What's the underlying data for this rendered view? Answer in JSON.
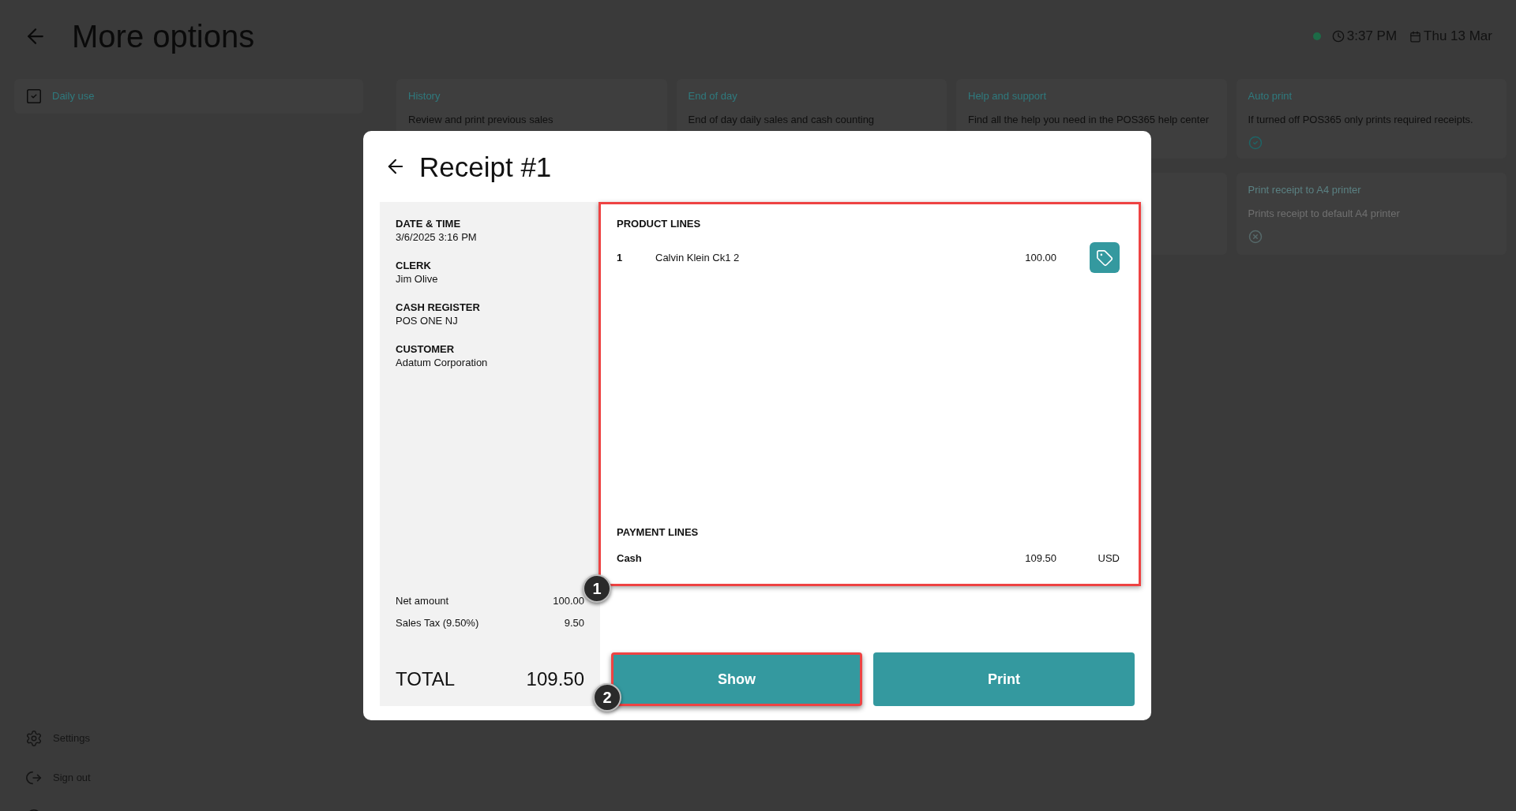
{
  "header": {
    "title": "More options",
    "time": "3:37 PM",
    "date": "Thu 13 Mar"
  },
  "sidebar": {
    "items": [
      {
        "label": "Daily use",
        "selected": true
      }
    ],
    "footer_items": [
      {
        "kind": "settings",
        "label": "Settings"
      },
      {
        "kind": "sign_out",
        "label": "Sign out"
      },
      {
        "kind": "help"
      }
    ]
  },
  "cards": [
    {
      "kind": "link",
      "title": "History",
      "description": "Review and print previous sales"
    },
    {
      "kind": "link",
      "title": "End of day",
      "description": "End of day daily sales and cash counting"
    },
    {
      "kind": "link",
      "title": "Help and support",
      "description": "Find all the help you need in the POS365 help center"
    },
    {
      "kind": "toggle",
      "title": "Auto print",
      "description": "If turned off POS365 only prints required receipts.",
      "on": true
    },
    {
      "kind": "blank"
    },
    {
      "kind": "toggle",
      "title": "Print receipt to A4 printer",
      "description": "Prints receipt to default A4 printer",
      "on": false
    }
  ],
  "receipt": {
    "title": "Receipt #1",
    "details": [
      {
        "label": "DATE & TIME",
        "value": "3/6/2025 3:16 PM"
      },
      {
        "label": "CLERK",
        "value": "Jim Olive"
      },
      {
        "label": "CASH REGISTER",
        "value": "POS ONE NJ"
      },
      {
        "label": "CUSTOMER",
        "value": "Adatum Corporation"
      }
    ],
    "summary": [
      {
        "label": "Net amount",
        "value": "100.00"
      },
      {
        "label": "Sales Tax (9.50%)",
        "value": "9.50"
      }
    ],
    "total": {
      "label": "TOTAL",
      "value": "109.50"
    },
    "lines_panel": {
      "highlighted": true,
      "callout": "1"
    },
    "product_lines": {
      "heading": "PRODUCT LINES",
      "rows": [
        {
          "qty": "1",
          "name": "Calvin Klein Ck1 2",
          "amount": "100.00"
        }
      ]
    },
    "payment_lines": {
      "heading": "PAYMENT LINES",
      "rows": [
        {
          "method": "Cash",
          "amount": "109.50",
          "currency": "USD"
        }
      ]
    },
    "buttons": [
      {
        "label": "Show",
        "highlighted": true,
        "callout": "2"
      },
      {
        "label": "Print",
        "highlighted": false
      }
    ]
  }
}
